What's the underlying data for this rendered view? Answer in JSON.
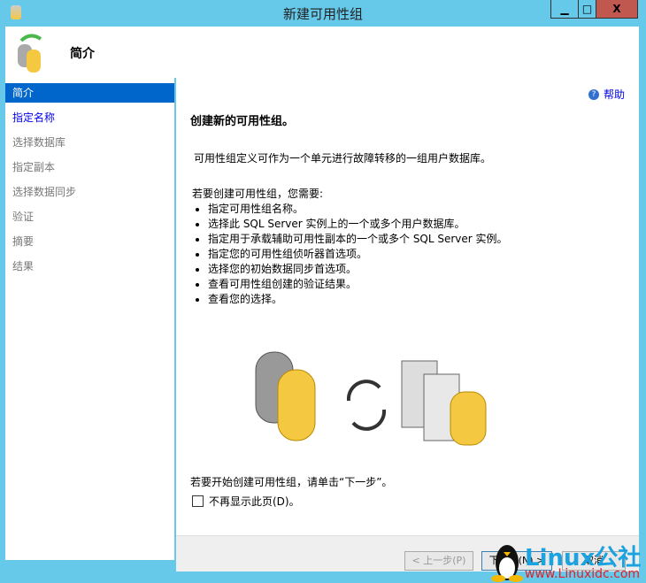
{
  "window": {
    "title": "新建可用性组",
    "minimize": "▁",
    "maximize": "□",
    "close": "X"
  },
  "header": {
    "title": "简介"
  },
  "nav": {
    "items": [
      {
        "label": "简介"
      },
      {
        "label": "指定名称"
      },
      {
        "label": "选择数据库"
      },
      {
        "label": "指定副本"
      },
      {
        "label": "选择数据同步"
      },
      {
        "label": "验证"
      },
      {
        "label": "摘要"
      },
      {
        "label": "结果"
      }
    ]
  },
  "main": {
    "help": "帮助",
    "heading": "创建新的可用性组。",
    "intro": "可用性组定义可作为一个单元进行故障转移的一组用户数据库。",
    "req_title": "若要创建可用性组，您需要:",
    "bullets": [
      "指定可用性组名称。",
      "选择此 SQL Server 实例上的一个或多个用户数据库。",
      "指定用于承载辅助可用性副本的一个或多个 SQL Server 实例。",
      "指定您的可用性组侦听器首选项。",
      "选择您的初始数据同步首选项。",
      "查看可用性组创建的验证结果。",
      "查看您的选择。"
    ],
    "start_text": "若要开始创建可用性组，请单击“下一步”。",
    "dont_show": "不再显示此页(D)。"
  },
  "buttons": {
    "prev": "< 上一步(P)",
    "next": "下一步(N) >",
    "cancel": "取消"
  },
  "watermark": {
    "brand": "Linux公社",
    "url": "www.Linuxidc.com"
  }
}
